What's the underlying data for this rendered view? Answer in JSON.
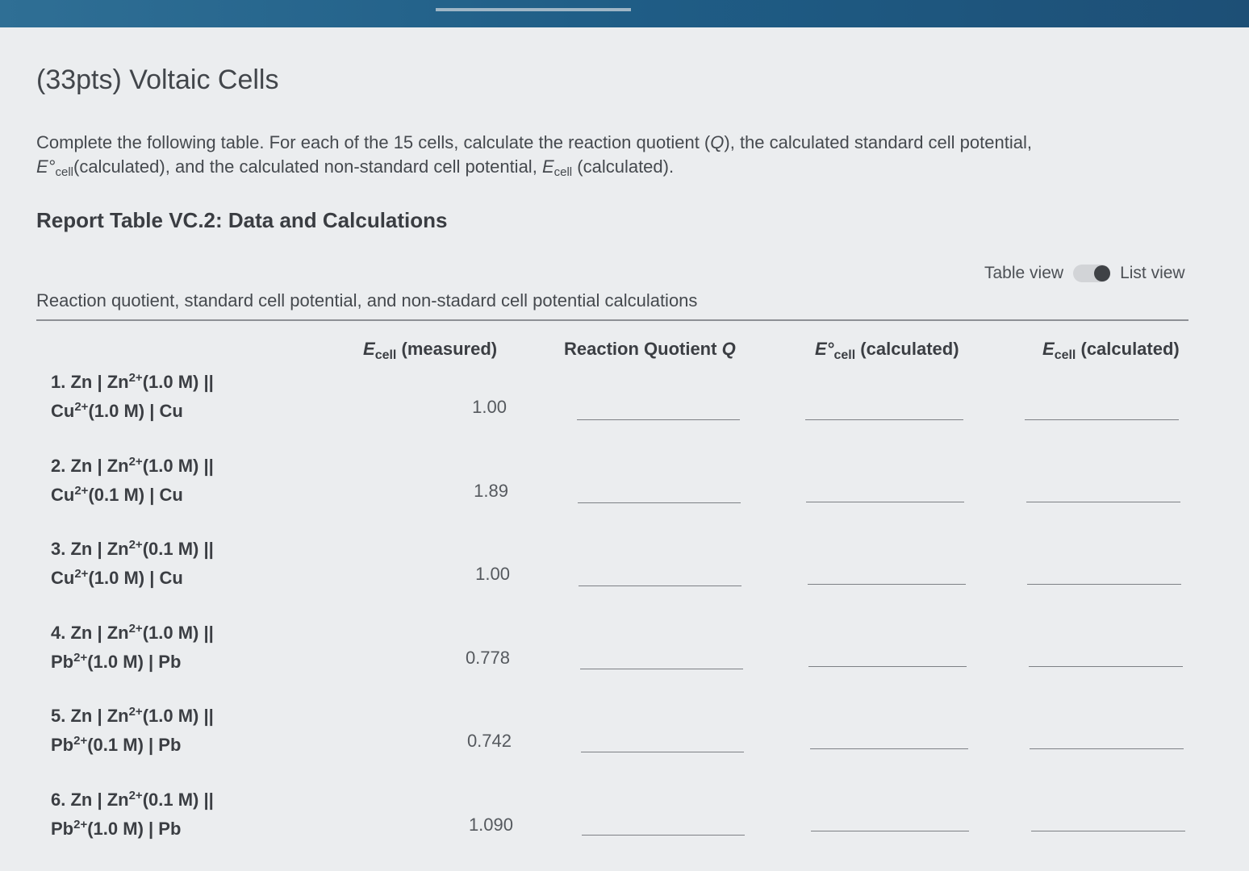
{
  "title": "(33pts) Voltaic Cells",
  "instructions": {
    "part1": "Complete the following table. For each of the 15 cells, calculate the reaction quotient (",
    "q_symbol": "Q",
    "part2": "), the calculated standard cell potential,",
    "e_std": "E°",
    "cell_sub": "cell",
    "part3": "(calculated), and the calculated non-standard cell potential,",
    "e_symbol": "E",
    "part4": "(calculated)."
  },
  "report_title": "Report Table VC.2: Data and Calculations",
  "view_toggle": {
    "table_label": "Table view",
    "list_label": "List view",
    "selected": "List view"
  },
  "section_caption": "Reaction quotient, standard cell potential, and non-stadard cell potential calculations",
  "columns": {
    "measured": {
      "symbol": "E",
      "sub": "cell",
      "rest": " (measured)"
    },
    "quotient": {
      "text": "Reaction Quotient ",
      "symbol": "Q"
    },
    "std_calc": {
      "symbol": "E°",
      "sub": "cell",
      "rest": " (calculated)"
    },
    "nonstd_calc": {
      "symbol": "E",
      "sub": "cell",
      "rest": " (calculated)"
    }
  },
  "rows": [
    {
      "line1_a": "1. Zn | Zn",
      "line1_sup": "2+",
      "line1_b": "(1.0 M) ||",
      "line2_a": "Cu",
      "line2_sup": "2+",
      "line2_b": "(1.0 M) | Cu",
      "measured": "1.00"
    },
    {
      "line1_a": "2. Zn | Zn",
      "line1_sup": "2+",
      "line1_b": "(1.0 M) ||",
      "line2_a": "Cu",
      "line2_sup": "2+",
      "line2_b": "(0.1 M) | Cu",
      "measured": "1.89"
    },
    {
      "line1_a": "3. Zn | Zn",
      "line1_sup": "2+",
      "line1_b": "(0.1 M) ||",
      "line2_a": "Cu",
      "line2_sup": "2+",
      "line2_b": "(1.0 M) | Cu",
      "measured": "1.00"
    },
    {
      "line1_a": "4. Zn | Zn",
      "line1_sup": "2+",
      "line1_b": "(1.0 M) ||",
      "line2_a": "Pb",
      "line2_sup": "2+",
      "line2_b": "(1.0 M) | Pb",
      "measured": "0.778"
    },
    {
      "line1_a": "5. Zn | Zn",
      "line1_sup": "2+",
      "line1_b": "(1.0 M) ||",
      "line2_a": "Pb",
      "line2_sup": "2+",
      "line2_b": "(0.1 M) | Pb",
      "measured": "0.742"
    },
    {
      "line1_a": "6. Zn | Zn",
      "line1_sup": "2+",
      "line1_b": "(0.1 M) ||",
      "line2_a": "Pb",
      "line2_sup": "2+",
      "line2_b": "(1.0 M) | Pb",
      "measured": "1.090"
    }
  ]
}
